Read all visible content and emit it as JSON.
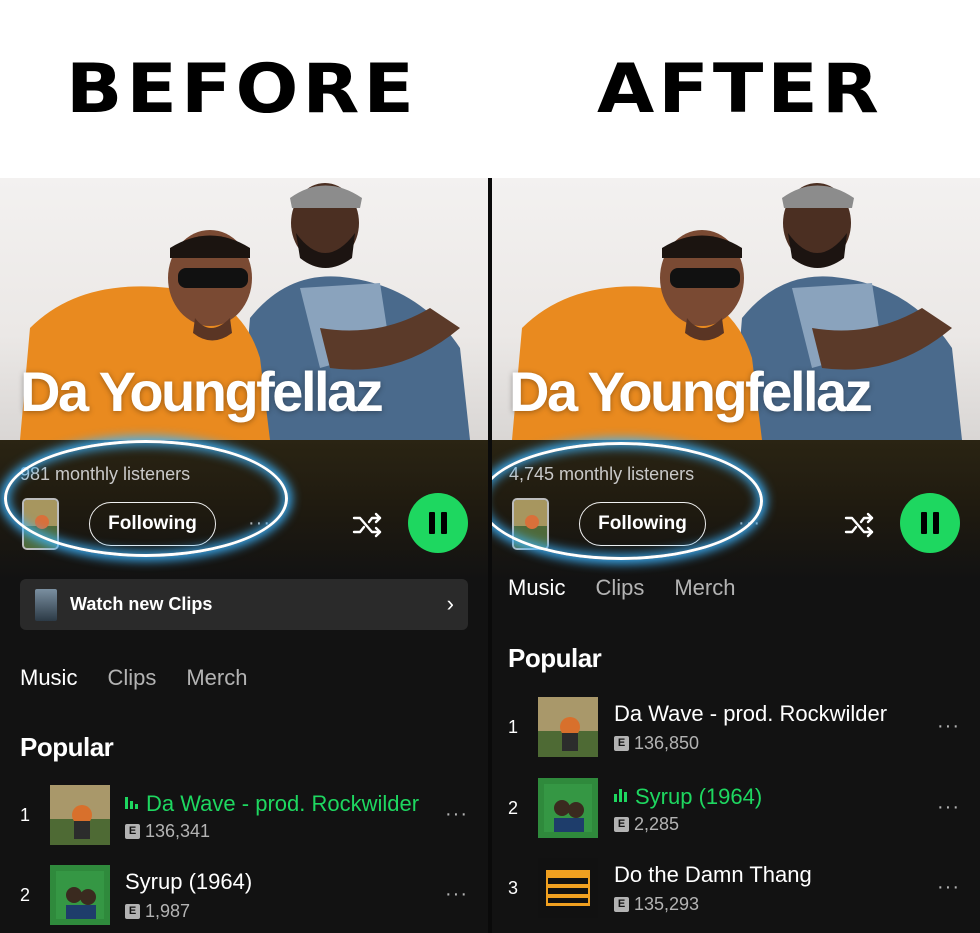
{
  "header": {
    "before": "BEFORE",
    "after": "AFTER"
  },
  "before": {
    "artist_name": "Da Youngfellaz",
    "monthly_listeners": "981 monthly listeners",
    "following_label": "Following",
    "more_label": "···",
    "clips_banner": {
      "label": "Watch new Clips",
      "chevron": "›"
    },
    "tabs": [
      {
        "label": "Music",
        "active": true
      },
      {
        "label": "Clips"
      },
      {
        "label": "Merch"
      }
    ],
    "section_title": "Popular",
    "tracks": [
      {
        "num": "1",
        "title": "Da Wave - prod. Rockwilder",
        "plays": "136,341",
        "badge": "E",
        "playing": true,
        "dots": "···"
      },
      {
        "num": "2",
        "title": "Syrup (1964)",
        "plays": "1,987",
        "badge": "E",
        "playing": false,
        "dots": "···"
      }
    ]
  },
  "after": {
    "artist_name": "Da Youngfellaz",
    "monthly_listeners": "4,745 monthly listeners",
    "following_label": "Following",
    "more_label": "···",
    "tabs": [
      {
        "label": "Music",
        "active": true
      },
      {
        "label": "Clips"
      },
      {
        "label": "Merch"
      }
    ],
    "section_title": "Popular",
    "tracks": [
      {
        "num": "1",
        "title": "Da Wave - prod. Rockwilder",
        "plays": "136,850",
        "badge": "E",
        "playing": false,
        "dots": "···"
      },
      {
        "num": "2",
        "title": "Syrup (1964)",
        "plays": "2,285",
        "badge": "E",
        "playing": true,
        "dots": "···"
      },
      {
        "num": "3",
        "title": "Do the Damn Thang",
        "plays": "135,293",
        "badge": "E",
        "playing": false,
        "dots": "···"
      }
    ]
  },
  "colors": {
    "accent": "#1ed760",
    "background": "#121212",
    "glow": "#3cb4ff"
  },
  "icons": [
    "shuffle-icon",
    "pause-icon",
    "more-icon",
    "chevron-right-icon",
    "explicit-icon",
    "equalizer-icon"
  ]
}
